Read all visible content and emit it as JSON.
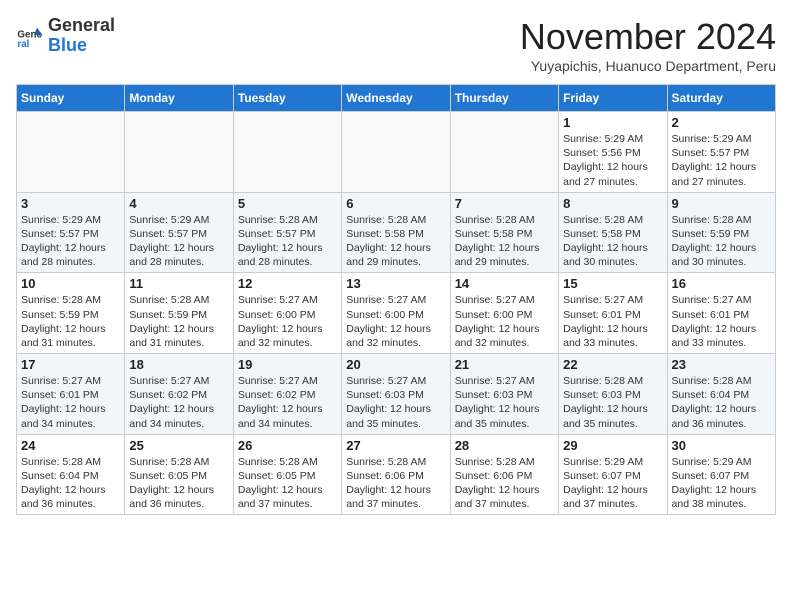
{
  "header": {
    "logo_general": "General",
    "logo_blue": "Blue",
    "month_year": "November 2024",
    "location": "Yuyapichis, Huanuco Department, Peru"
  },
  "weekdays": [
    "Sunday",
    "Monday",
    "Tuesday",
    "Wednesday",
    "Thursday",
    "Friday",
    "Saturday"
  ],
  "weeks": [
    [
      {
        "day": "",
        "info": ""
      },
      {
        "day": "",
        "info": ""
      },
      {
        "day": "",
        "info": ""
      },
      {
        "day": "",
        "info": ""
      },
      {
        "day": "",
        "info": ""
      },
      {
        "day": "1",
        "info": "Sunrise: 5:29 AM\nSunset: 5:56 PM\nDaylight: 12 hours\nand 27 minutes."
      },
      {
        "day": "2",
        "info": "Sunrise: 5:29 AM\nSunset: 5:57 PM\nDaylight: 12 hours\nand 27 minutes."
      }
    ],
    [
      {
        "day": "3",
        "info": "Sunrise: 5:29 AM\nSunset: 5:57 PM\nDaylight: 12 hours\nand 28 minutes."
      },
      {
        "day": "4",
        "info": "Sunrise: 5:29 AM\nSunset: 5:57 PM\nDaylight: 12 hours\nand 28 minutes."
      },
      {
        "day": "5",
        "info": "Sunrise: 5:28 AM\nSunset: 5:57 PM\nDaylight: 12 hours\nand 28 minutes."
      },
      {
        "day": "6",
        "info": "Sunrise: 5:28 AM\nSunset: 5:58 PM\nDaylight: 12 hours\nand 29 minutes."
      },
      {
        "day": "7",
        "info": "Sunrise: 5:28 AM\nSunset: 5:58 PM\nDaylight: 12 hours\nand 29 minutes."
      },
      {
        "day": "8",
        "info": "Sunrise: 5:28 AM\nSunset: 5:58 PM\nDaylight: 12 hours\nand 30 minutes."
      },
      {
        "day": "9",
        "info": "Sunrise: 5:28 AM\nSunset: 5:59 PM\nDaylight: 12 hours\nand 30 minutes."
      }
    ],
    [
      {
        "day": "10",
        "info": "Sunrise: 5:28 AM\nSunset: 5:59 PM\nDaylight: 12 hours\nand 31 minutes."
      },
      {
        "day": "11",
        "info": "Sunrise: 5:28 AM\nSunset: 5:59 PM\nDaylight: 12 hours\nand 31 minutes."
      },
      {
        "day": "12",
        "info": "Sunrise: 5:27 AM\nSunset: 6:00 PM\nDaylight: 12 hours\nand 32 minutes."
      },
      {
        "day": "13",
        "info": "Sunrise: 5:27 AM\nSunset: 6:00 PM\nDaylight: 12 hours\nand 32 minutes."
      },
      {
        "day": "14",
        "info": "Sunrise: 5:27 AM\nSunset: 6:00 PM\nDaylight: 12 hours\nand 32 minutes."
      },
      {
        "day": "15",
        "info": "Sunrise: 5:27 AM\nSunset: 6:01 PM\nDaylight: 12 hours\nand 33 minutes."
      },
      {
        "day": "16",
        "info": "Sunrise: 5:27 AM\nSunset: 6:01 PM\nDaylight: 12 hours\nand 33 minutes."
      }
    ],
    [
      {
        "day": "17",
        "info": "Sunrise: 5:27 AM\nSunset: 6:01 PM\nDaylight: 12 hours\nand 34 minutes."
      },
      {
        "day": "18",
        "info": "Sunrise: 5:27 AM\nSunset: 6:02 PM\nDaylight: 12 hours\nand 34 minutes."
      },
      {
        "day": "19",
        "info": "Sunrise: 5:27 AM\nSunset: 6:02 PM\nDaylight: 12 hours\nand 34 minutes."
      },
      {
        "day": "20",
        "info": "Sunrise: 5:27 AM\nSunset: 6:03 PM\nDaylight: 12 hours\nand 35 minutes."
      },
      {
        "day": "21",
        "info": "Sunrise: 5:27 AM\nSunset: 6:03 PM\nDaylight: 12 hours\nand 35 minutes."
      },
      {
        "day": "22",
        "info": "Sunrise: 5:28 AM\nSunset: 6:03 PM\nDaylight: 12 hours\nand 35 minutes."
      },
      {
        "day": "23",
        "info": "Sunrise: 5:28 AM\nSunset: 6:04 PM\nDaylight: 12 hours\nand 36 minutes."
      }
    ],
    [
      {
        "day": "24",
        "info": "Sunrise: 5:28 AM\nSunset: 6:04 PM\nDaylight: 12 hours\nand 36 minutes."
      },
      {
        "day": "25",
        "info": "Sunrise: 5:28 AM\nSunset: 6:05 PM\nDaylight: 12 hours\nand 36 minutes."
      },
      {
        "day": "26",
        "info": "Sunrise: 5:28 AM\nSunset: 6:05 PM\nDaylight: 12 hours\nand 37 minutes."
      },
      {
        "day": "27",
        "info": "Sunrise: 5:28 AM\nSunset: 6:06 PM\nDaylight: 12 hours\nand 37 minutes."
      },
      {
        "day": "28",
        "info": "Sunrise: 5:28 AM\nSunset: 6:06 PM\nDaylight: 12 hours\nand 37 minutes."
      },
      {
        "day": "29",
        "info": "Sunrise: 5:29 AM\nSunset: 6:07 PM\nDaylight: 12 hours\nand 37 minutes."
      },
      {
        "day": "30",
        "info": "Sunrise: 5:29 AM\nSunset: 6:07 PM\nDaylight: 12 hours\nand 38 minutes."
      }
    ]
  ]
}
